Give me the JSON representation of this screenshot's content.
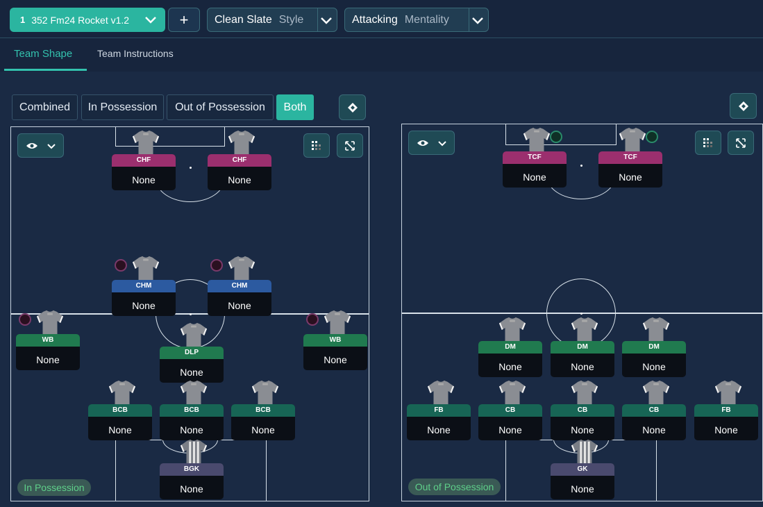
{
  "topbar": {
    "tactic_number": "1",
    "tactic_name": "352 Fm24 Rocket v1.2",
    "add_label": "+",
    "style": {
      "value": "Clean Slate",
      "label": "Style"
    },
    "mentality": {
      "value": "Attacking",
      "label": "Mentality"
    }
  },
  "tabs": [
    "Team Shape",
    "Team Instructions"
  ],
  "view_modes": [
    "Combined",
    "In Possession",
    "Out of Possession",
    "Both"
  ],
  "active_view_mode": "Both",
  "in_possession": {
    "label": "In Possession",
    "players": [
      {
        "role": "CHF",
        "duty": "None",
        "color": "#9b2f6e"
      },
      {
        "role": "CHF",
        "duty": "None",
        "color": "#9b2f6e"
      },
      {
        "role": "CHM",
        "duty": "None",
        "color": "#2c5aa0"
      },
      {
        "role": "CHM",
        "duty": "None",
        "color": "#2c5aa0"
      },
      {
        "role": "WB",
        "duty": "None",
        "color": "#207a4f"
      },
      {
        "role": "DLP",
        "duty": "None",
        "color": "#207a4f"
      },
      {
        "role": "WB",
        "duty": "None",
        "color": "#207a4f"
      },
      {
        "role": "BCB",
        "duty": "None",
        "color": "#176555"
      },
      {
        "role": "BCB",
        "duty": "None",
        "color": "#176555"
      },
      {
        "role": "BCB",
        "duty": "None",
        "color": "#176555"
      },
      {
        "role": "BGK",
        "duty": "None",
        "color": "#4a4a6e"
      }
    ]
  },
  "out_of_possession": {
    "label": "Out of Possession",
    "players": [
      {
        "role": "TCF",
        "duty": "None",
        "color": "#9b2f6e"
      },
      {
        "role": "TCF",
        "duty": "None",
        "color": "#9b2f6e"
      },
      {
        "role": "DM",
        "duty": "None",
        "color": "#207a4f"
      },
      {
        "role": "DM",
        "duty": "None",
        "color": "#207a4f"
      },
      {
        "role": "DM",
        "duty": "None",
        "color": "#207a4f"
      },
      {
        "role": "FB",
        "duty": "None",
        "color": "#176555"
      },
      {
        "role": "CB",
        "duty": "None",
        "color": "#176555"
      },
      {
        "role": "CB",
        "duty": "None",
        "color": "#176555"
      },
      {
        "role": "CB",
        "duty": "None",
        "color": "#176555"
      },
      {
        "role": "FB",
        "duty": "None",
        "color": "#176555"
      },
      {
        "role": "GK",
        "duty": "None",
        "color": "#4a4a6e"
      }
    ]
  },
  "icons": {
    "eye": "eye-icon",
    "chevron": "chevron-down-icon",
    "grid": "grid-icon",
    "expand": "expand-icon",
    "diamond": "diamond-icon",
    "shirt": "shirt-icon"
  },
  "colors": {
    "accent": "#2bb5a0",
    "background": "#1a2a44"
  }
}
